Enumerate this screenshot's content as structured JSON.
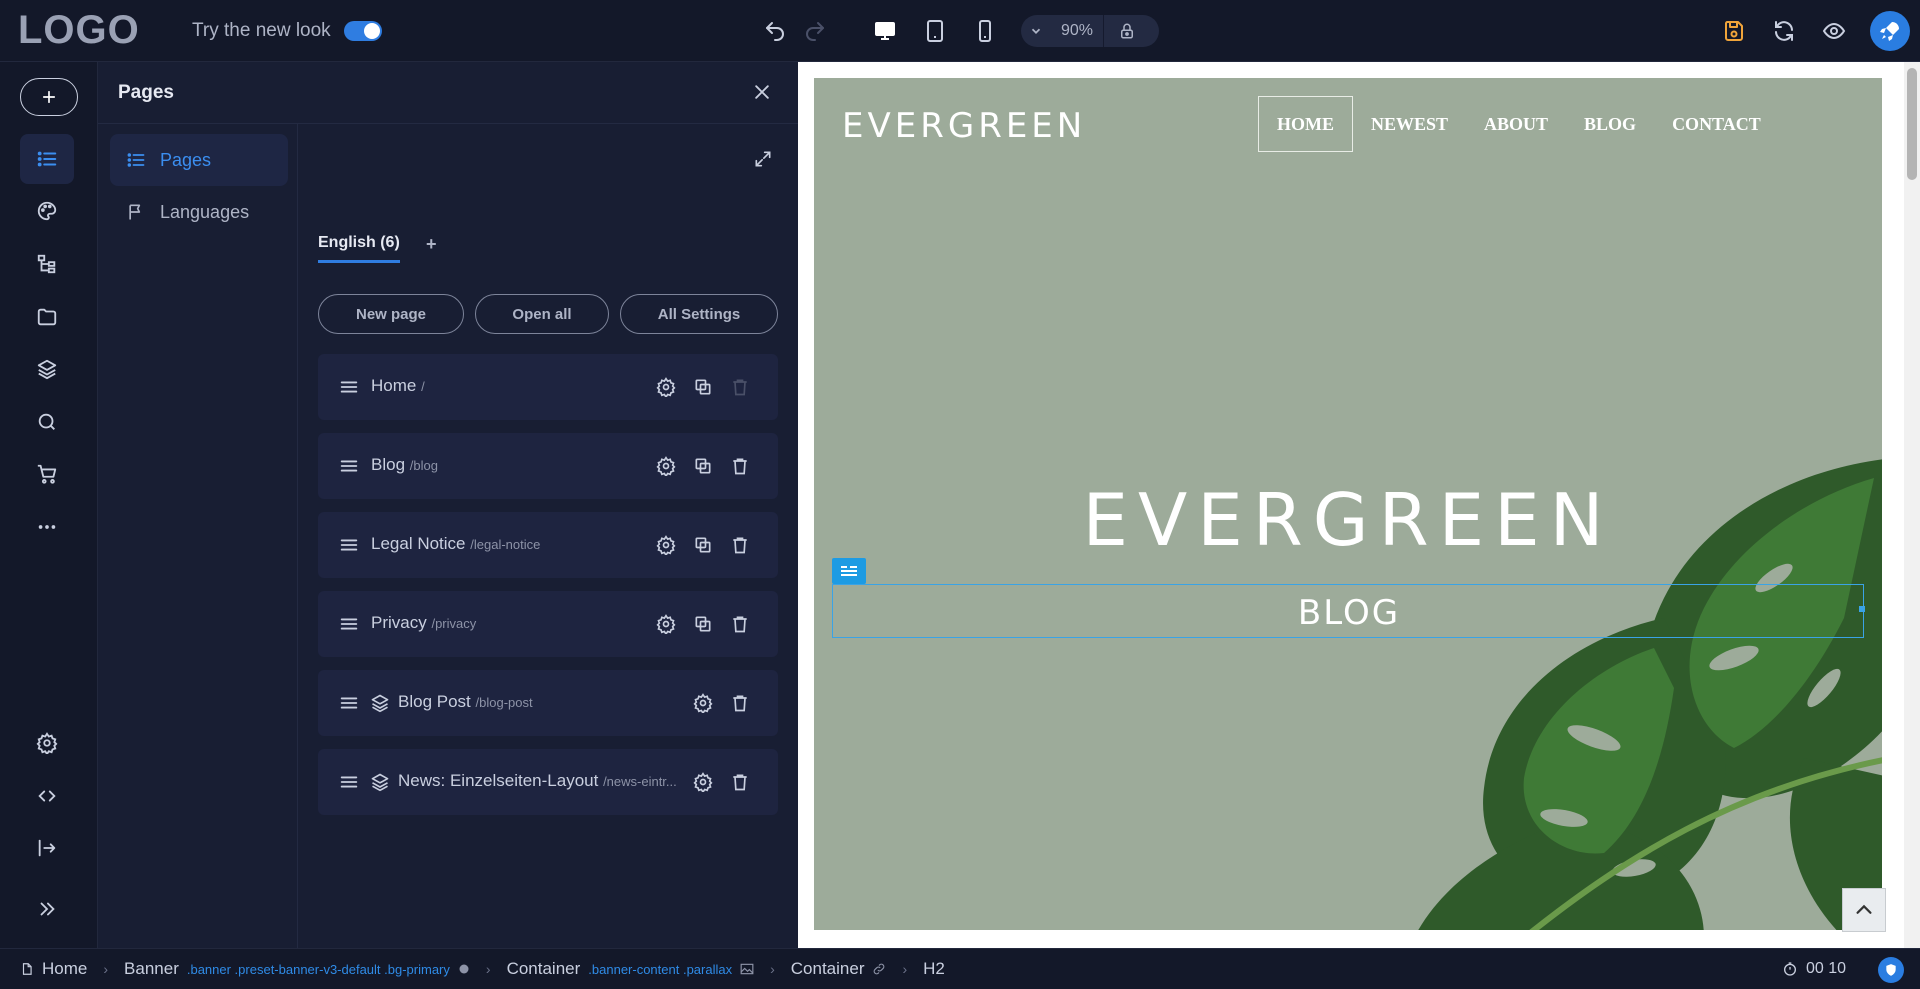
{
  "topbar": {
    "logo": "LOGO",
    "newlook_label": "Try the new look",
    "zoom_value": "90%"
  },
  "pages_panel": {
    "title": "Pages",
    "subnav": [
      {
        "label": "Pages"
      },
      {
        "label": "Languages"
      }
    ],
    "language_tab": "English (6)",
    "add_language": "+",
    "buttons": {
      "new_page": "New page",
      "open_all": "Open all",
      "all_settings": "All Settings"
    },
    "pages": [
      {
        "name": "Home",
        "slug": "/"
      },
      {
        "name": "Blog",
        "slug": "/blog"
      },
      {
        "name": "Legal Notice",
        "slug": "/legal-notice"
      },
      {
        "name": "Privacy",
        "slug": "/privacy"
      },
      {
        "name": "Blog Post",
        "slug": "/blog-post"
      },
      {
        "name": "News: Einzelseiten-Layout",
        "slug": "/news-eintr..."
      }
    ]
  },
  "preview": {
    "site_logo": "EVERGREEN",
    "nav": [
      "HOME",
      "NEWEST",
      "ABOUT",
      "BLOG",
      "CONTACT"
    ],
    "hero_title": "EVERGREEN",
    "hero_subtitle": "BLOG",
    "banner_color": "#9dab9a"
  },
  "statusbar": {
    "crumbs": [
      {
        "label": "Home",
        "cls": ""
      },
      {
        "label": "Banner",
        "cls": ".banner .preset-banner-v3-default .bg-primary"
      },
      {
        "label": "Container",
        "cls": ".banner-content .parallax"
      },
      {
        "label": "Container",
        "cls": ""
      },
      {
        "label": "H2",
        "cls": ""
      }
    ],
    "timer": "00 10"
  },
  "colors": {
    "accent": "#2f7de1",
    "save_icon": "#f0a43a",
    "selection": "#3aa3e6"
  }
}
